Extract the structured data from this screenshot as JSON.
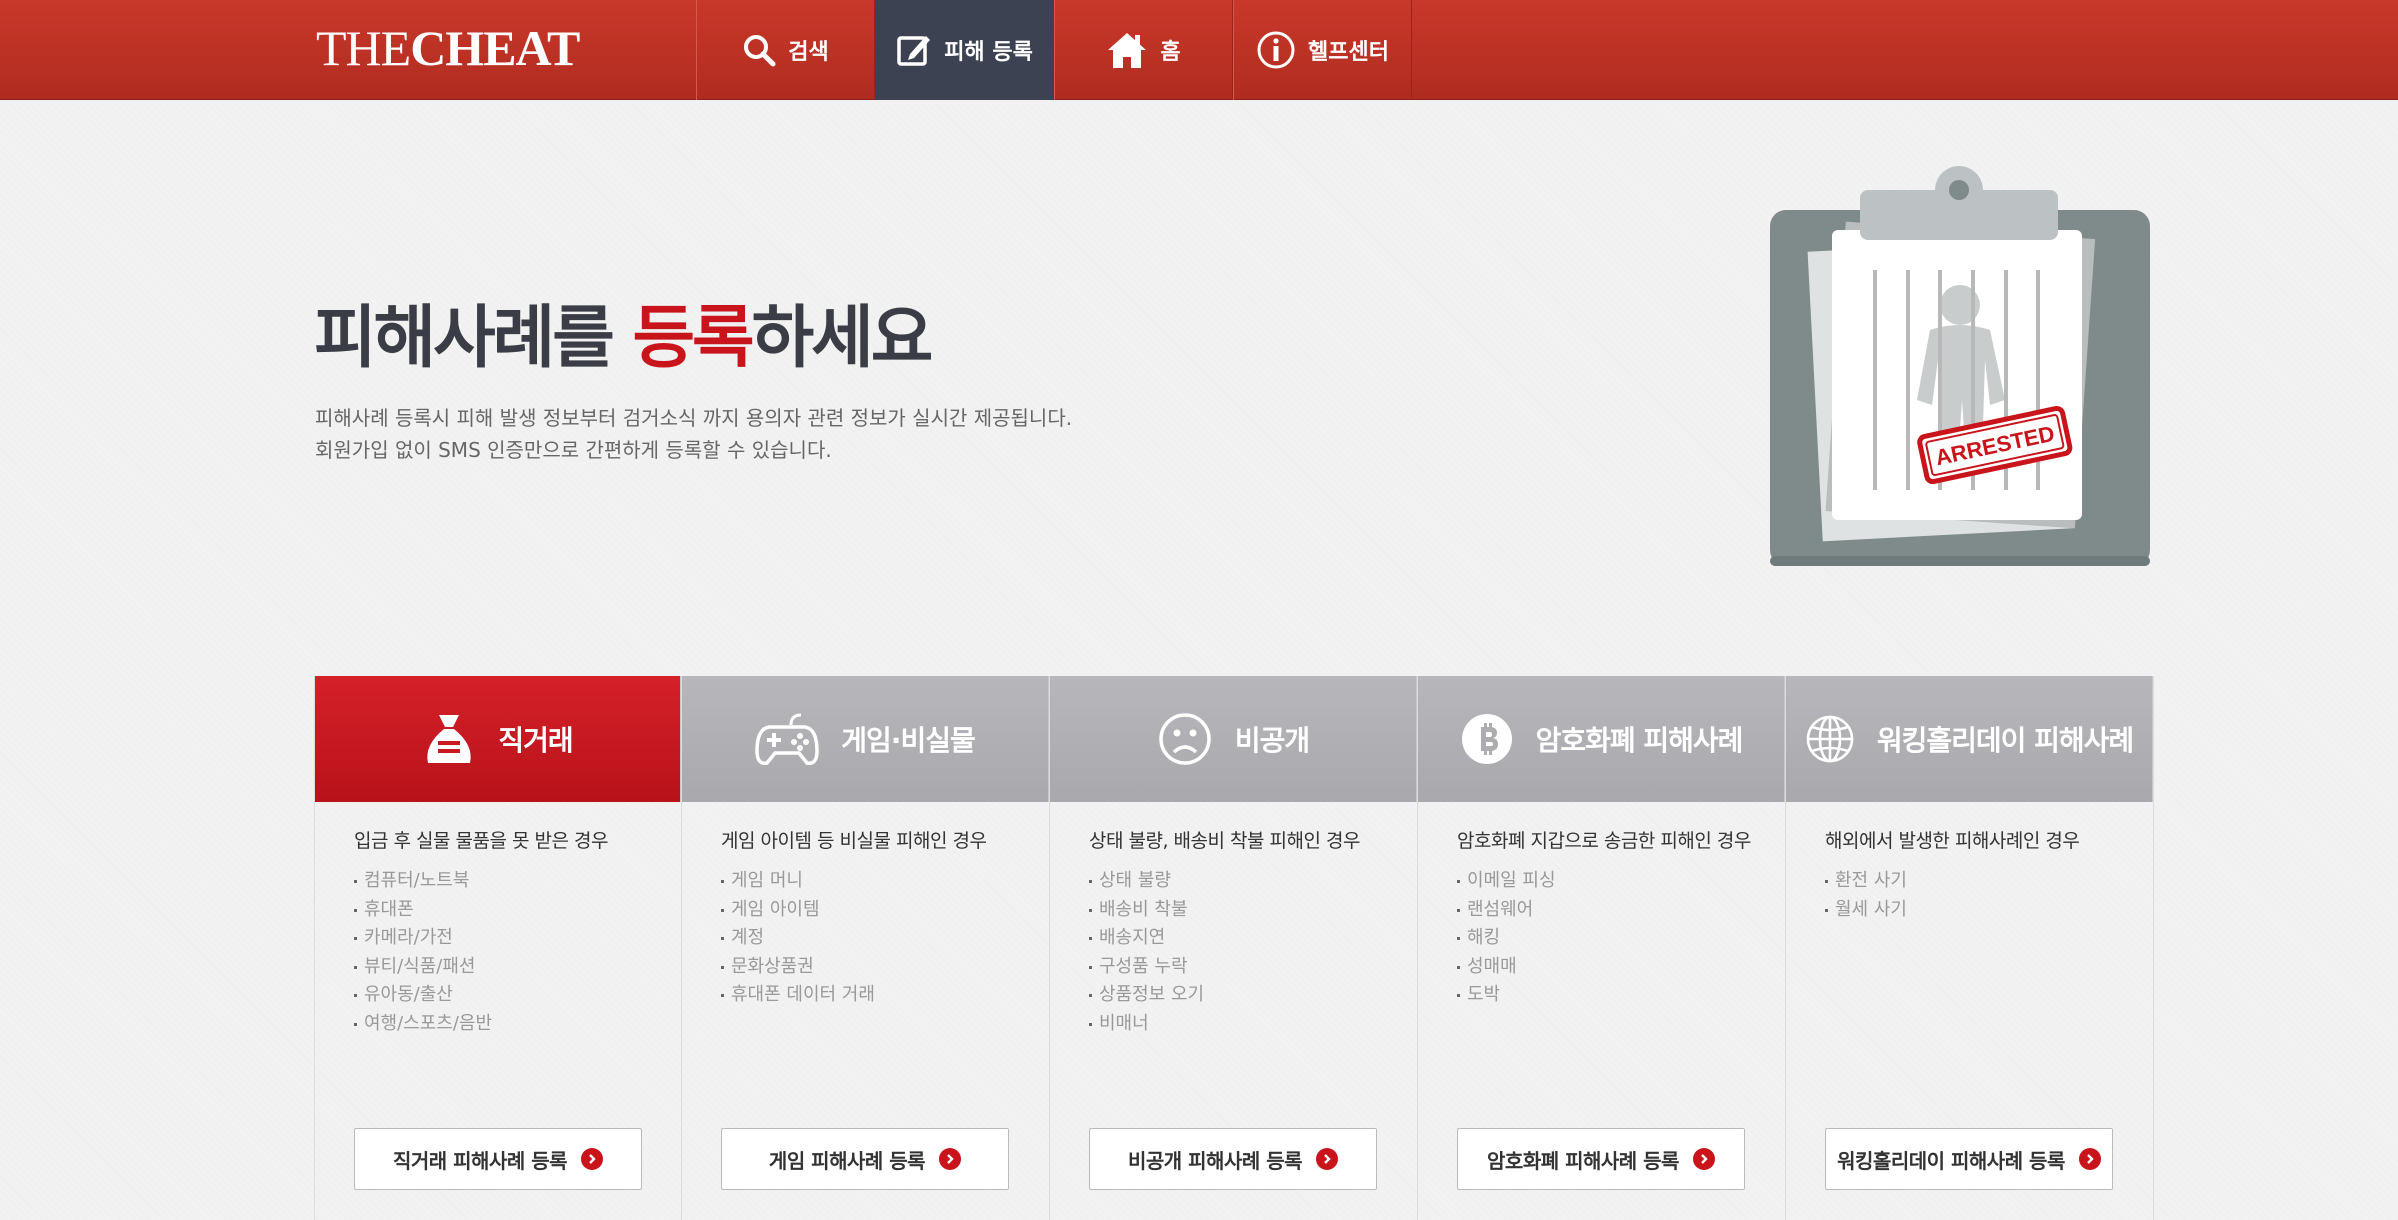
{
  "header": {
    "logo_light": "THE",
    "logo_bold": "CHEAT",
    "nav": [
      {
        "label": "검색",
        "icon": "search-icon"
      },
      {
        "label": "피해 등록",
        "icon": "edit-icon",
        "active": true
      },
      {
        "label": "홈",
        "icon": "home-icon"
      },
      {
        "label": "헬프센터",
        "icon": "info-icon"
      }
    ]
  },
  "hero": {
    "title_part1": "피해사례를 ",
    "title_highlight": "등록",
    "title_part2": "하세요",
    "desc_line1": "피해사례 등록시 피해 발생 정보부터 검거소식 까지 용의자 관련 정보가 실시간 제공됩니다.",
    "desc_line2": "회원가입 없이 SMS 인증만으로 간편하게 등록할 수 있습니다.",
    "stamp_text": "ARRESTED"
  },
  "categories": [
    {
      "title": "직거래",
      "icon": "money-bag-icon",
      "active": true,
      "subtitle": "입금 후 실물 물품을 못 받은 경우",
      "items": [
        "컴퓨터/노트북",
        "휴대폰",
        "카메라/가전",
        "뷰티/식품/패션",
        "유아동/출산",
        "여행/스포츠/음반"
      ],
      "button": "직거래 피해사례 등록"
    },
    {
      "title": "게임·비실물",
      "icon": "gamepad-icon",
      "subtitle": "게임 아이템 등 비실물 피해인 경우",
      "items": [
        "게임 머니",
        "게임 아이템",
        "계정",
        "문화상품권",
        "휴대폰 데이터 거래"
      ],
      "button": "게임 피해사례 등록"
    },
    {
      "title": "비공개",
      "icon": "sad-face-icon",
      "subtitle": "상태 불량, 배송비 착불 피해인 경우",
      "items": [
        "상태 불량",
        "배송비 착불",
        "배송지연",
        "구성품 누락",
        "상품정보 오기",
        "비매너"
      ],
      "button": "비공개 피해사례 등록"
    },
    {
      "title": "암호화폐 피해사례",
      "icon": "crypto-coin-icon",
      "subtitle": "암호화폐 지갑으로 송금한 피해인 경우",
      "items": [
        "이메일 피싱",
        "랜섬웨어",
        "해킹",
        "성매매",
        "도박"
      ],
      "button": "암호화폐 피해사례 등록"
    },
    {
      "title": "워킹홀리데이 피해사례",
      "icon": "globe-icon",
      "subtitle": "해외에서 발생한 피해사례인 경우",
      "items": [
        "환전 사기",
        "월세 사기"
      ],
      "button": "워킹홀리데이 피해사례 등록"
    }
  ]
}
